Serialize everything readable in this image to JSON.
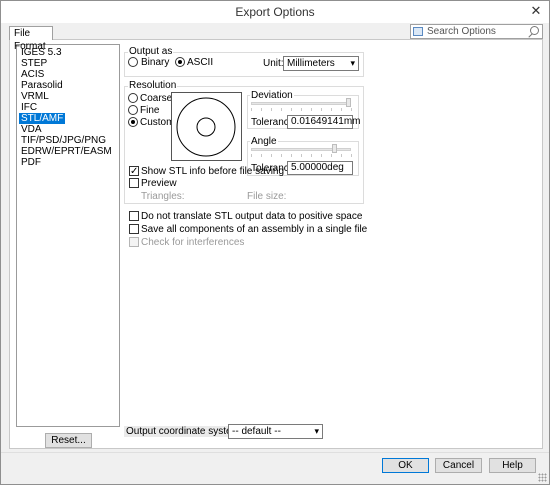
{
  "window": {
    "title": "Export Options"
  },
  "search": {
    "placeholder": "Search Options"
  },
  "tab": {
    "label": "File Format"
  },
  "formats": [
    "IGES 5.3",
    "STEP",
    "ACIS",
    "Parasolid",
    "VRML",
    "IFC",
    "STL/AMF",
    "VDA",
    "TIF/PSD/JPG/PNG",
    "EDRW/EPRT/EASM",
    "PDF"
  ],
  "selected_format": "STL/AMF",
  "reset_label": "Reset...",
  "output": {
    "group_label": "Output as",
    "binary": "Binary",
    "ascii": "ASCII",
    "selected": "ASCII",
    "unit_label": "Unit:",
    "unit_value": "Millimeters"
  },
  "resolution": {
    "group_label": "Resolution",
    "coarse": "Coarse",
    "fine": "Fine",
    "custom": "Custom",
    "selected": "Custom",
    "deviation_label": "Deviation",
    "deviation_tolerance_label": "Tolerance:",
    "deviation_tolerance": "0.01649141mm",
    "angle_label": "Angle",
    "angle_tolerance_label": "Tolerance:",
    "angle_tolerance": "5.00000deg",
    "show_info": "Show STL info before file saving",
    "show_info_checked": true,
    "preview": "Preview",
    "preview_checked": false,
    "triangles_label": "Triangles:",
    "file_size_label": "File size:"
  },
  "options": {
    "no_translate": "Do not translate STL output data to positive space",
    "save_all": "Save all components of an assembly in a single file",
    "check_interferences": "Check for interferences"
  },
  "coord": {
    "label": "Output coordinate system:",
    "value": "-- default --"
  },
  "footer": {
    "ok": "OK",
    "cancel": "Cancel",
    "help": "Help"
  }
}
